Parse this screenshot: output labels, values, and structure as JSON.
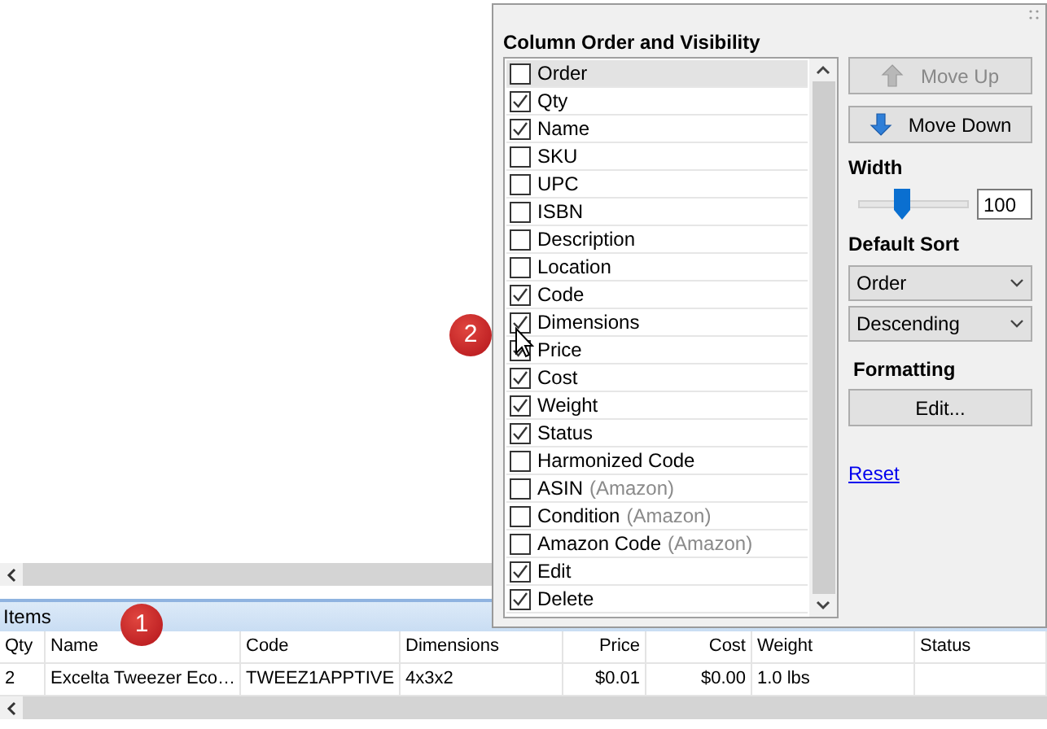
{
  "table": {
    "section_title": "Items",
    "columns": [
      "Qty",
      "Name",
      "Code",
      "Dimensions",
      "Price",
      "Cost",
      "Weight",
      "Status"
    ],
    "rows": [
      [
        "2",
        "Excelta Tweezer Eco…",
        "TWEEZ1APPTIVE",
        "4x3x2",
        "$0.01",
        "$0.00",
        "1.0 lbs",
        ""
      ]
    ]
  },
  "column_panel": {
    "title": "Column Order and Visibility",
    "columns": [
      {
        "label": "Order",
        "checked": false,
        "selected": true
      },
      {
        "label": "Qty",
        "checked": true,
        "selected": false
      },
      {
        "label": "Name",
        "checked": true,
        "selected": false
      },
      {
        "label": "SKU",
        "checked": false,
        "selected": false
      },
      {
        "label": "UPC",
        "checked": false,
        "selected": false
      },
      {
        "label": "ISBN",
        "checked": false,
        "selected": false
      },
      {
        "label": "Description",
        "checked": false,
        "selected": false
      },
      {
        "label": "Location",
        "checked": false,
        "selected": false
      },
      {
        "label": "Code",
        "checked": true,
        "selected": false
      },
      {
        "label": "Dimensions",
        "checked": true,
        "selected": false
      },
      {
        "label": "Price",
        "checked": true,
        "selected": false
      },
      {
        "label": "Cost",
        "checked": true,
        "selected": false
      },
      {
        "label": "Weight",
        "checked": true,
        "selected": false
      },
      {
        "label": "Status",
        "checked": true,
        "selected": false
      },
      {
        "label": "Harmonized Code",
        "checked": false,
        "selected": false
      },
      {
        "label": "ASIN",
        "note": "(Amazon)",
        "checked": false,
        "selected": false
      },
      {
        "label": "Condition",
        "note": "(Amazon)",
        "checked": false,
        "selected": false
      },
      {
        "label": "Amazon Code",
        "note": "(Amazon)",
        "checked": false,
        "selected": false
      },
      {
        "label": "Edit",
        "checked": true,
        "selected": false
      },
      {
        "label": "Delete",
        "checked": true,
        "selected": false
      }
    ],
    "move_up": {
      "label": "Move Up",
      "disabled": true
    },
    "move_down": {
      "label": "Move Down",
      "disabled": false
    },
    "width_label": "Width",
    "width_slider": {
      "level": 0.4
    },
    "width_value": "100",
    "sort_label": "Default Sort",
    "sort_field": "Order",
    "sort_direction": "Descending",
    "formatting_label": "Formatting",
    "edit_button": "Edit...",
    "reset_link": "Reset"
  },
  "callouts": [
    "1",
    "2"
  ]
}
